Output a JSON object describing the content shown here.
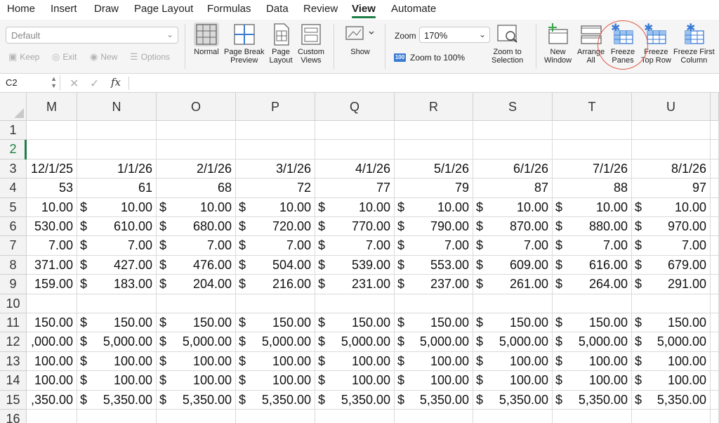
{
  "tabs": [
    {
      "label": "Home",
      "active": false
    },
    {
      "label": "Insert",
      "active": false
    },
    {
      "label": "Draw",
      "active": false
    },
    {
      "label": "Page Layout",
      "active": false
    },
    {
      "label": "Formulas",
      "active": false
    },
    {
      "label": "Data",
      "active": false
    },
    {
      "label": "Review",
      "active": false
    },
    {
      "label": "View",
      "active": true
    },
    {
      "label": "Automate",
      "active": false
    }
  ],
  "ribbon": {
    "sheet_view_value": "Default",
    "sheet_view_actions": [
      "Keep",
      "Exit",
      "New",
      "Options"
    ],
    "workbook_views": [
      {
        "label": "Normal",
        "icon": "normal-view-icon",
        "pressed": true
      },
      {
        "label": "Page Break\nPreview",
        "icon": "page-break-preview-icon",
        "pressed": false
      },
      {
        "label": "Page\nLayout",
        "icon": "page-layout-icon",
        "pressed": false
      },
      {
        "label": "Custom\nViews",
        "icon": "custom-views-icon",
        "pressed": false
      }
    ],
    "show_label": "Show",
    "zoom_label": "Zoom",
    "zoom_value": "170%",
    "zoom_100_label": "Zoom to 100%",
    "zoom_to_selection_label": "Zoom to\nSelection",
    "window_buttons": [
      {
        "label": "New\nWindow",
        "icon": "new-window-icon"
      },
      {
        "label": "Arrange\nAll",
        "icon": "arrange-all-icon"
      },
      {
        "label": "Freeze\nPanes",
        "icon": "freeze-panes-icon"
      },
      {
        "label": "Freeze\nTop Row",
        "icon": "freeze-top-row-icon"
      },
      {
        "label": "Freeze First\nColumn",
        "icon": "freeze-first-column-icon"
      }
    ],
    "accent_color": "#1e7e45",
    "annotation_color": "#e35b4a"
  },
  "formula_bar": {
    "name_box": "C2",
    "fx_label": "fx",
    "content": ""
  },
  "sheet": {
    "columns": [
      "M",
      "N",
      "O",
      "P",
      "Q",
      "R",
      "S",
      "T",
      "U"
    ],
    "selected_row": "2",
    "rows": [
      {
        "num": "1",
        "cells": [
          [
            "",
            ""
          ],
          [
            "",
            ""
          ],
          [
            "",
            ""
          ],
          [
            "",
            ""
          ],
          [
            "",
            ""
          ],
          [
            "",
            ""
          ],
          [
            "",
            ""
          ],
          [
            "",
            ""
          ],
          [
            "",
            ""
          ]
        ]
      },
      {
        "num": "2",
        "cells": [
          [
            "",
            ""
          ],
          [
            "",
            ""
          ],
          [
            "",
            ""
          ],
          [
            "",
            ""
          ],
          [
            "",
            ""
          ],
          [
            "",
            ""
          ],
          [
            "",
            ""
          ],
          [
            "",
            ""
          ],
          [
            "",
            ""
          ]
        ]
      },
      {
        "num": "3",
        "cells": [
          [
            "",
            "12/1/25"
          ],
          [
            "",
            "1/1/26"
          ],
          [
            "",
            "2/1/26"
          ],
          [
            "",
            "3/1/26"
          ],
          [
            "",
            "4/1/26"
          ],
          [
            "",
            "5/1/26"
          ],
          [
            "",
            "6/1/26"
          ],
          [
            "",
            "7/1/26"
          ],
          [
            "",
            "8/1/26"
          ]
        ]
      },
      {
        "num": "4",
        "cells": [
          [
            "",
            "53"
          ],
          [
            "",
            "61"
          ],
          [
            "",
            "68"
          ],
          [
            "",
            "72"
          ],
          [
            "",
            "77"
          ],
          [
            "",
            "79"
          ],
          [
            "",
            "87"
          ],
          [
            "",
            "88"
          ],
          [
            "",
            "97"
          ]
        ]
      },
      {
        "num": "5",
        "cells": [
          [
            "",
            "10.00"
          ],
          [
            "$",
            "10.00"
          ],
          [
            "$",
            "10.00"
          ],
          [
            "$",
            "10.00"
          ],
          [
            "$",
            "10.00"
          ],
          [
            "$",
            "10.00"
          ],
          [
            "$",
            "10.00"
          ],
          [
            "$",
            "10.00"
          ],
          [
            "$",
            "10.00"
          ]
        ]
      },
      {
        "num": "6",
        "cells": [
          [
            "",
            "530.00"
          ],
          [
            "$",
            "610.00"
          ],
          [
            "$",
            "680.00"
          ],
          [
            "$",
            "720.00"
          ],
          [
            "$",
            "770.00"
          ],
          [
            "$",
            "790.00"
          ],
          [
            "$",
            "870.00"
          ],
          [
            "$",
            "880.00"
          ],
          [
            "$",
            "970.00"
          ]
        ]
      },
      {
        "num": "7",
        "cells": [
          [
            "",
            "7.00"
          ],
          [
            "$",
            "7.00"
          ],
          [
            "$",
            "7.00"
          ],
          [
            "$",
            "7.00"
          ],
          [
            "$",
            "7.00"
          ],
          [
            "$",
            "7.00"
          ],
          [
            "$",
            "7.00"
          ],
          [
            "$",
            "7.00"
          ],
          [
            "$",
            "7.00"
          ]
        ]
      },
      {
        "num": "8",
        "cells": [
          [
            "",
            "371.00"
          ],
          [
            "$",
            "427.00"
          ],
          [
            "$",
            "476.00"
          ],
          [
            "$",
            "504.00"
          ],
          [
            "$",
            "539.00"
          ],
          [
            "$",
            "553.00"
          ],
          [
            "$",
            "609.00"
          ],
          [
            "$",
            "616.00"
          ],
          [
            "$",
            "679.00"
          ]
        ]
      },
      {
        "num": "9",
        "cells": [
          [
            "",
            "159.00"
          ],
          [
            "$",
            "183.00"
          ],
          [
            "$",
            "204.00"
          ],
          [
            "$",
            "216.00"
          ],
          [
            "$",
            "231.00"
          ],
          [
            "$",
            "237.00"
          ],
          [
            "$",
            "261.00"
          ],
          [
            "$",
            "264.00"
          ],
          [
            "$",
            "291.00"
          ]
        ]
      },
      {
        "num": "10",
        "cells": [
          [
            "",
            ""
          ],
          [
            "",
            ""
          ],
          [
            "",
            ""
          ],
          [
            "",
            ""
          ],
          [
            "",
            ""
          ],
          [
            "",
            ""
          ],
          [
            "",
            ""
          ],
          [
            "",
            ""
          ],
          [
            "",
            ""
          ]
        ]
      },
      {
        "num": "11",
        "cells": [
          [
            "",
            "150.00"
          ],
          [
            "$",
            "150.00"
          ],
          [
            "$",
            "150.00"
          ],
          [
            "$",
            "150.00"
          ],
          [
            "$",
            "150.00"
          ],
          [
            "$",
            "150.00"
          ],
          [
            "$",
            "150.00"
          ],
          [
            "$",
            "150.00"
          ],
          [
            "$",
            "150.00"
          ]
        ]
      },
      {
        "num": "12",
        "cells": [
          [
            "",
            ",000.00"
          ],
          [
            "$",
            "5,000.00"
          ],
          [
            "$",
            "5,000.00"
          ],
          [
            "$",
            "5,000.00"
          ],
          [
            "$",
            "5,000.00"
          ],
          [
            "$",
            "5,000.00"
          ],
          [
            "$",
            "5,000.00"
          ],
          [
            "$",
            "5,000.00"
          ],
          [
            "$",
            "5,000.00"
          ]
        ]
      },
      {
        "num": "13",
        "cells": [
          [
            "",
            "100.00"
          ],
          [
            "$",
            "100.00"
          ],
          [
            "$",
            "100.00"
          ],
          [
            "$",
            "100.00"
          ],
          [
            "$",
            "100.00"
          ],
          [
            "$",
            "100.00"
          ],
          [
            "$",
            "100.00"
          ],
          [
            "$",
            "100.00"
          ],
          [
            "$",
            "100.00"
          ]
        ]
      },
      {
        "num": "14",
        "cells": [
          [
            "",
            "100.00"
          ],
          [
            "$",
            "100.00"
          ],
          [
            "$",
            "100.00"
          ],
          [
            "$",
            "100.00"
          ],
          [
            "$",
            "100.00"
          ],
          [
            "$",
            "100.00"
          ],
          [
            "$",
            "100.00"
          ],
          [
            "$",
            "100.00"
          ],
          [
            "$",
            "100.00"
          ]
        ]
      },
      {
        "num": "15",
        "cells": [
          [
            "",
            ",350.00"
          ],
          [
            "$",
            "5,350.00"
          ],
          [
            "$",
            "5,350.00"
          ],
          [
            "$",
            "5,350.00"
          ],
          [
            "$",
            "5,350.00"
          ],
          [
            "$",
            "5,350.00"
          ],
          [
            "$",
            "5,350.00"
          ],
          [
            "$",
            "5,350.00"
          ],
          [
            "$",
            "5,350.00"
          ]
        ]
      },
      {
        "num": "16",
        "cells": [
          [
            "",
            ""
          ],
          [
            "",
            ""
          ],
          [
            "",
            ""
          ],
          [
            "",
            ""
          ],
          [
            "",
            ""
          ],
          [
            "",
            ""
          ],
          [
            "",
            ""
          ],
          [
            "",
            ""
          ],
          [
            "",
            ""
          ]
        ]
      }
    ]
  }
}
